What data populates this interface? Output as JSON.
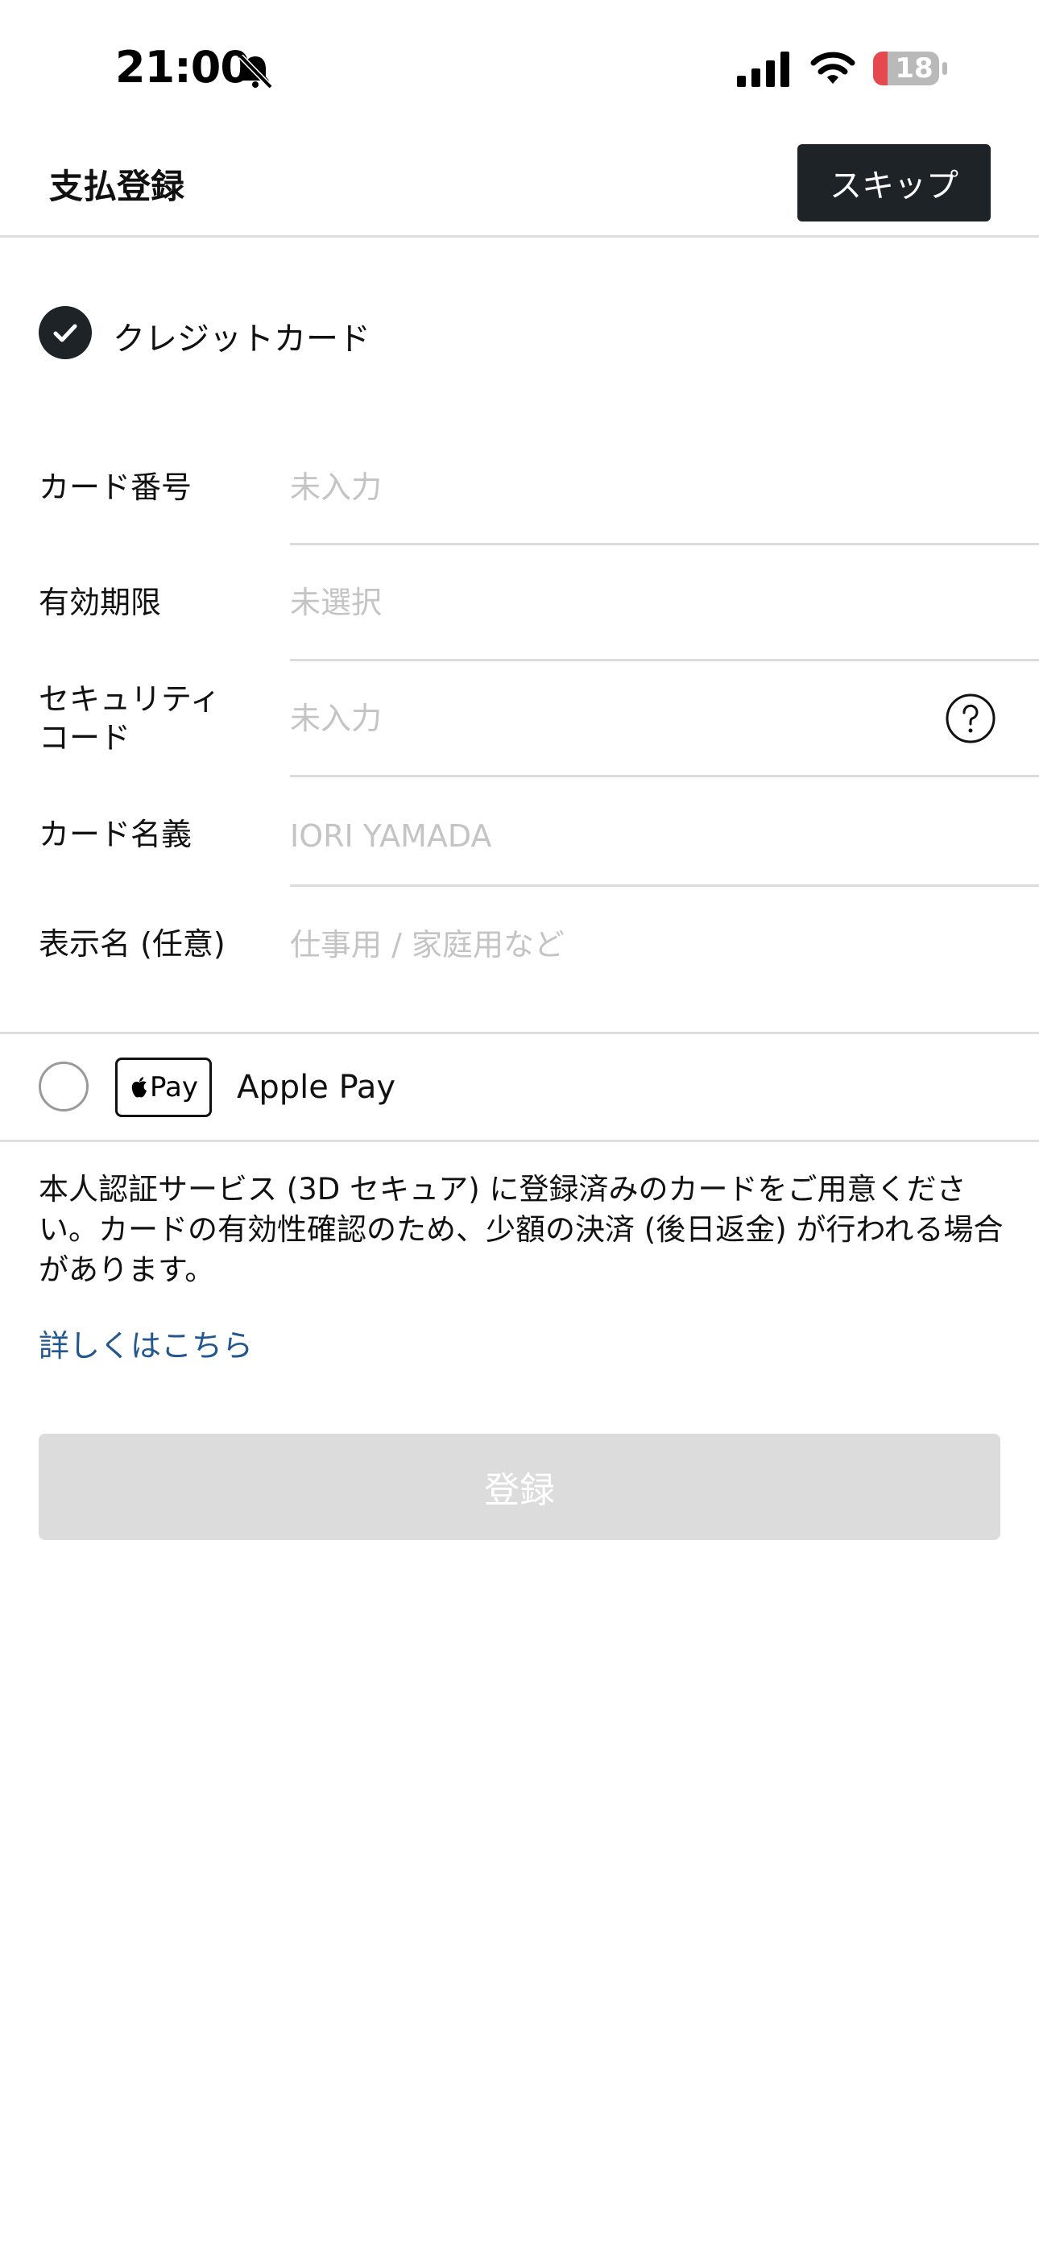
{
  "status_bar": {
    "time": "21:00",
    "battery": "18",
    "icons": [
      "bell-slash-icon",
      "signal-icon",
      "wifi-icon",
      "battery-icon"
    ]
  },
  "header": {
    "title": "支払登録",
    "skip_label": "スキップ"
  },
  "credit_card": {
    "label": "クレジットカード",
    "selected": true,
    "fields": {
      "number": {
        "label": "カード番号",
        "placeholder": "未入力"
      },
      "expiry": {
        "label": "有効期限",
        "placeholder": "未選択"
      },
      "security_line1": "セキュリティ",
      "security_line2": "コード",
      "security": {
        "placeholder": "未入力"
      },
      "holder": {
        "label": "カード名義",
        "placeholder": "IORI YAMADA"
      },
      "display": {
        "label": "表示名 (任意)",
        "placeholder": "仕事用 / 家庭用など"
      }
    }
  },
  "apple_pay": {
    "label": "Apple Pay",
    "logo_text": "Pay",
    "selected": false
  },
  "notice": {
    "text": "本人認証サービス (3D セキュア) に登録済みのカードをご用意ください。カードの有効性確認のため、少額の決済 (後日返金) が行われる場合があります。",
    "link": "詳しくはこちら"
  },
  "register_label": "登録",
  "colors": {
    "dark": "#1e2328",
    "link": "#23578f",
    "disabled": "#dcdcdc",
    "battery_low": "#e5484d"
  }
}
